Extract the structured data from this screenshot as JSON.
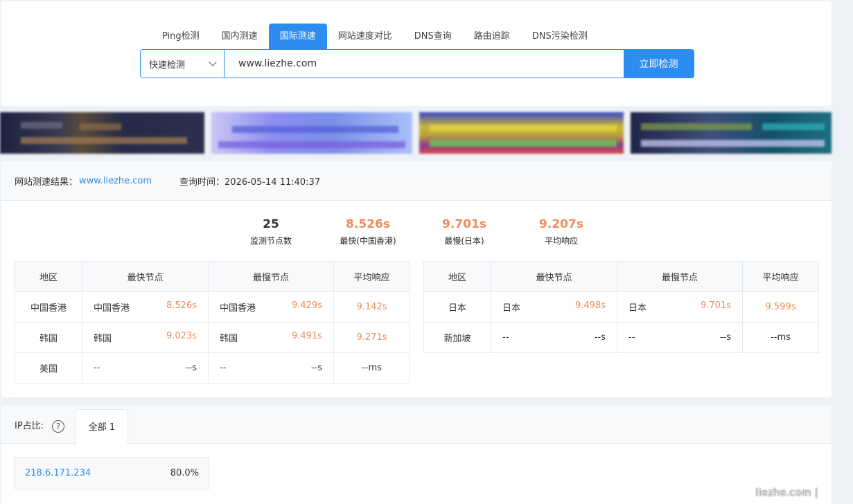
{
  "tabs": [
    "Ping检测",
    "国内测速",
    "国际测速",
    "网站速度对比",
    "DNS查询",
    "路由追踪",
    "DNS污染检测"
  ],
  "search": {
    "mode": "快速检测",
    "url_value": "www.liezhe.com",
    "button_label": "立即检测"
  },
  "result": {
    "label": "网站测速结果：",
    "domain": "www.liezhe.com",
    "query_time": "查询时间：2026-05-14 11:40:37",
    "stats": [
      {
        "value": "25",
        "label": "监测节点数"
      },
      {
        "value": "8.526s",
        "label": "最快(中国香港)"
      },
      {
        "value": "9.701s",
        "label": "最慢(日本)"
      },
      {
        "value": "9.207s",
        "label": "平均响应"
      }
    ],
    "headers": [
      "地区",
      "最快节点",
      "最慢节点",
      "平均响应"
    ],
    "left_rows": [
      {
        "region": "中国香港",
        "fast_node": "中国香港",
        "fast_time": "8.526s",
        "slow_node": "中国香港",
        "slow_time": "9.429s",
        "avg": "9.142s"
      },
      {
        "region": "韩国",
        "fast_node": "韩国",
        "fast_time": "9.023s",
        "slow_node": "韩国",
        "slow_time": "9.491s",
        "avg": "9.271s"
      },
      {
        "region": "美国",
        "fast_node": "--",
        "fast_time": "--s",
        "slow_node": "--",
        "slow_time": "--s",
        "avg": "--ms"
      }
    ],
    "right_rows": [
      {
        "region": "日本",
        "fast_node": "日本",
        "fast_time": "9.498s",
        "slow_node": "日本",
        "slow_time": "9.701s",
        "avg": "9.599s"
      },
      {
        "region": "新加坡",
        "fast_node": "--",
        "fast_time": "--s",
        "slow_node": "--",
        "slow_time": "--s",
        "avg": "--ms"
      }
    ]
  },
  "ip": {
    "label": "IP占比:",
    "help_icon": "question-circle-icon",
    "tab_label": "全部 1",
    "rows": [
      {
        "ip": "218.6.171.234",
        "percent": "80.0%"
      }
    ]
  },
  "watermark": "liezhe.com |",
  "colors": {
    "accent": "#2d8cf0",
    "speed": "#f08c5a"
  }
}
